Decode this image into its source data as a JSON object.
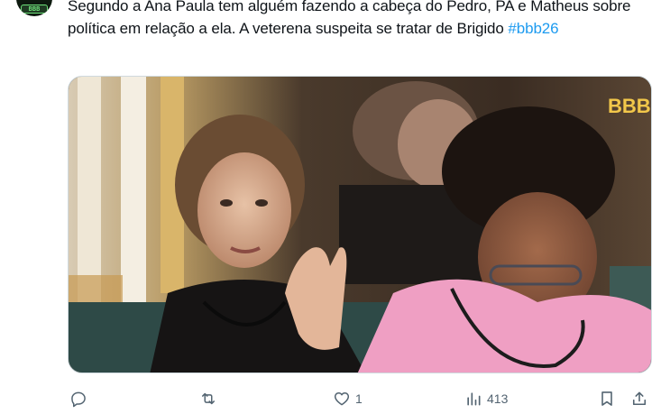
{
  "tweet": {
    "text": "Segundo a Ana Paula tem alguém fazendo a cabeça do Pedro, PA e Matheus sobre política em relação a ela. A veterena suspeita se tratar de Brigido ",
    "hashtag": "#bbb26"
  },
  "avatar": {
    "logo_text": "BBB"
  },
  "media": {
    "watermark": "BBB"
  },
  "actions": {
    "reply": {
      "icon": "reply-icon",
      "count": ""
    },
    "retweet": {
      "icon": "retweet-icon",
      "count": ""
    },
    "like": {
      "icon": "heart-icon",
      "count": "1"
    },
    "views": {
      "icon": "views-icon",
      "count": "413"
    },
    "bookmark": {
      "icon": "bookmark-icon"
    },
    "share": {
      "icon": "share-icon"
    }
  },
  "colors": {
    "accent": "#1d9bf0",
    "icon_gray": "#536471",
    "text": "#0f1419"
  }
}
